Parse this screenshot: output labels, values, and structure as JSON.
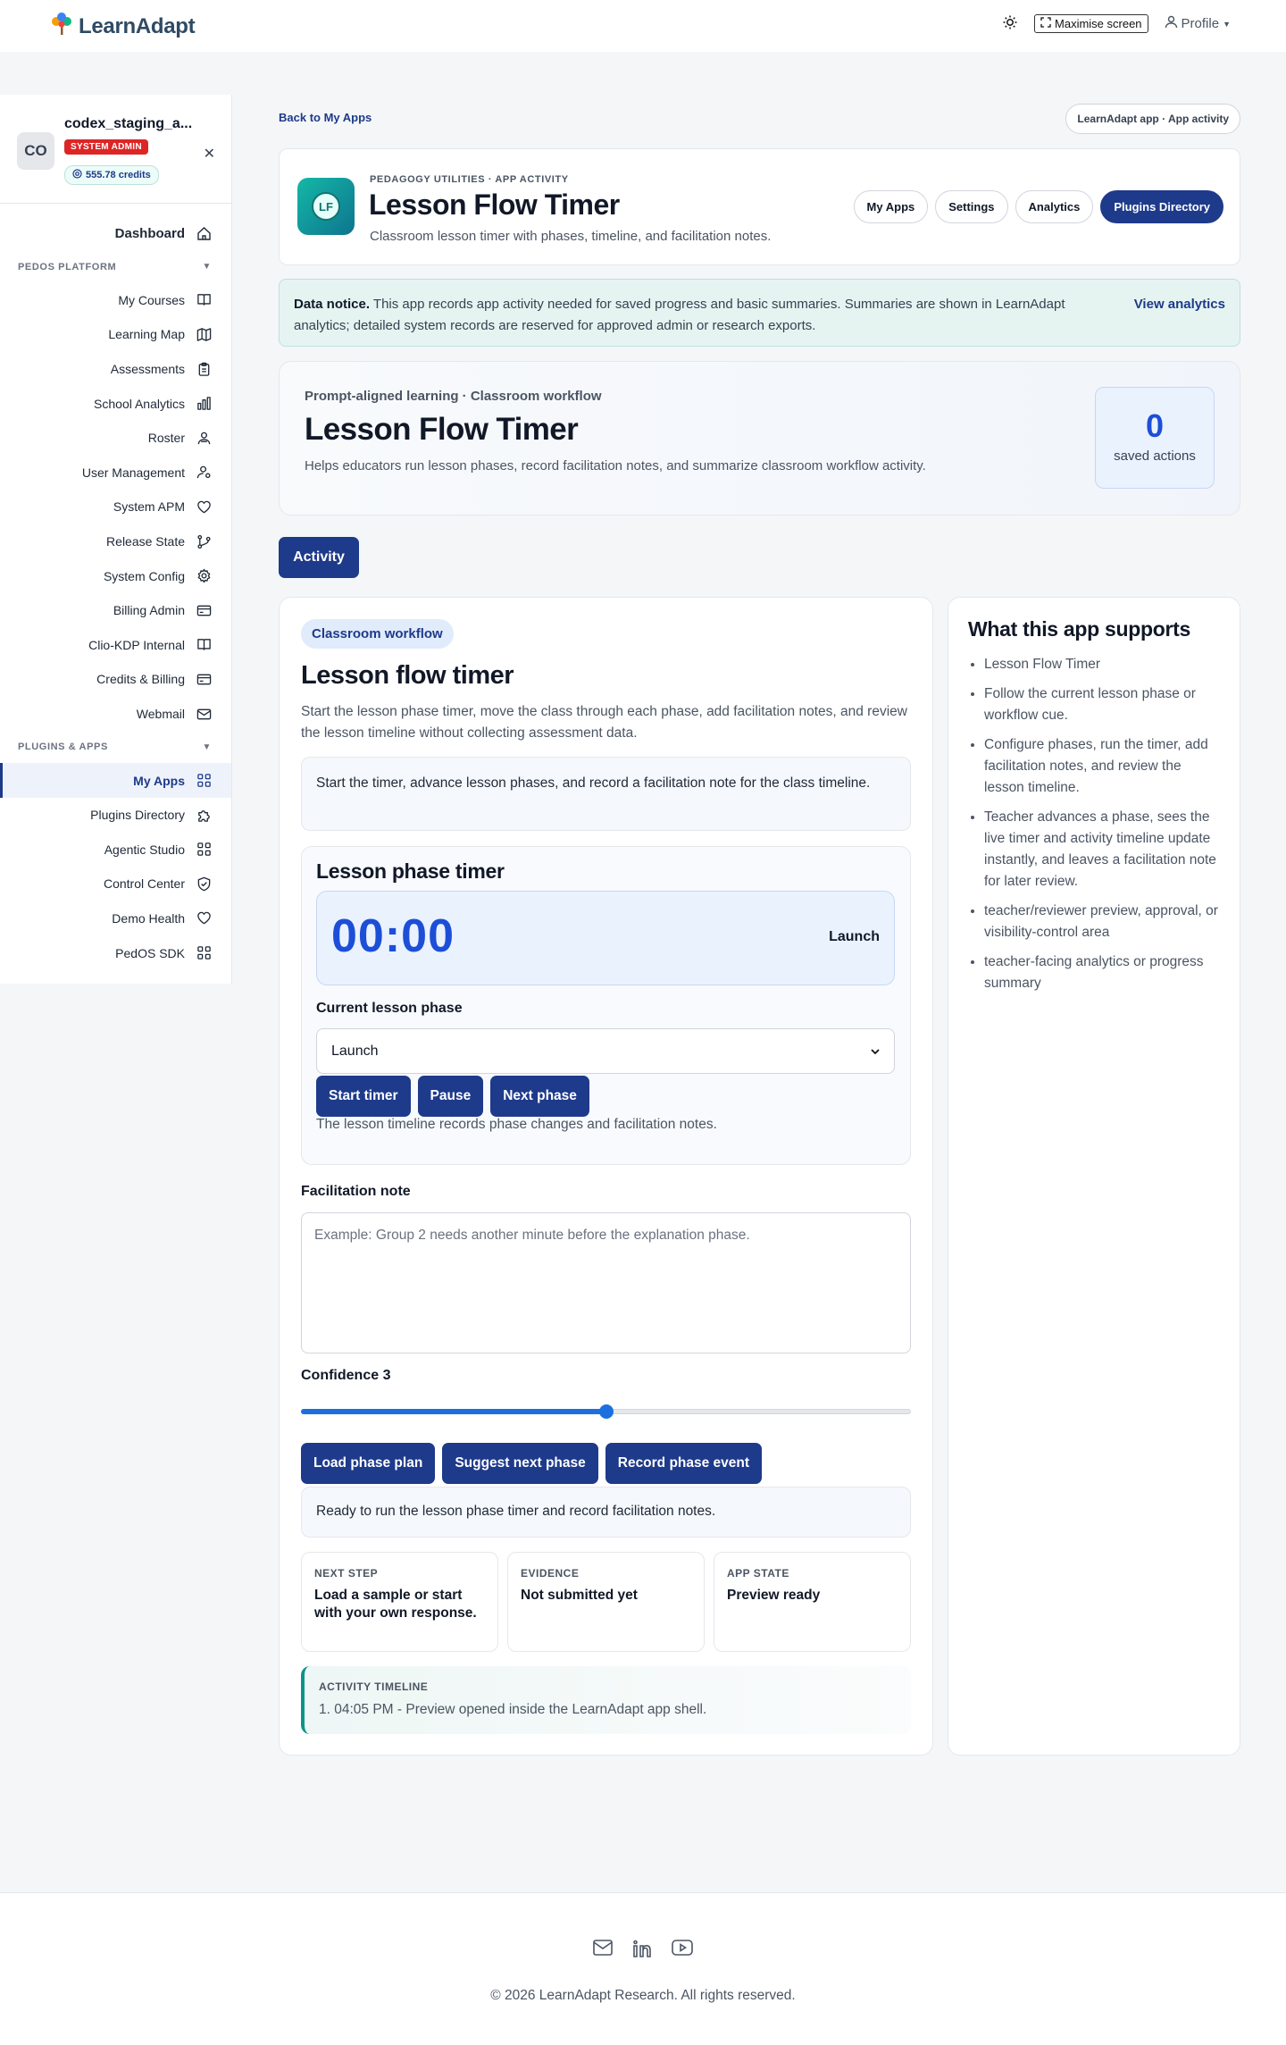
{
  "brand": {
    "name": "LearnAdapt"
  },
  "topbar": {
    "maximise_label": "Maximise screen",
    "profile_label": "Profile"
  },
  "sidebar": {
    "user": {
      "initials": "CO",
      "name": "codex_staging_a...",
      "role_badge": "SYSTEM ADMIN",
      "credits": "555.78 credits"
    },
    "dashboard": "Dashboard",
    "section_platform": "PEDOS PLATFORM",
    "platform_items": [
      {
        "label": "My Courses",
        "icon": "book-icon"
      },
      {
        "label": "Learning Map",
        "icon": "map-icon"
      },
      {
        "label": "Assessments",
        "icon": "clipboard-icon"
      },
      {
        "label": "School Analytics",
        "icon": "bar-chart-icon"
      },
      {
        "label": "Roster",
        "icon": "users-icon"
      },
      {
        "label": "User Management",
        "icon": "user-cog-icon"
      },
      {
        "label": "System APM",
        "icon": "heart-icon"
      },
      {
        "label": "Release State",
        "icon": "git-branch-icon"
      },
      {
        "label": "System Config",
        "icon": "gear-icon"
      },
      {
        "label": "Billing Admin",
        "icon": "credit-card-icon"
      },
      {
        "label": "Clio-KDP Internal",
        "icon": "book-icon"
      },
      {
        "label": "Credits & Billing",
        "icon": "credit-card-icon"
      },
      {
        "label": "Webmail",
        "icon": "mail-icon"
      }
    ],
    "section_plugins": "PLUGINS & APPS",
    "plugin_items": [
      {
        "label": "My Apps",
        "icon": "grid-icon"
      },
      {
        "label": "Plugins Directory",
        "icon": "puzzle-icon"
      },
      {
        "label": "Agentic Studio",
        "icon": "grid-icon"
      },
      {
        "label": "Control Center",
        "icon": "shield-icon"
      },
      {
        "label": "Demo Health",
        "icon": "heart-icon"
      },
      {
        "label": "PedOS SDK",
        "icon": "grid-icon"
      }
    ]
  },
  "page": {
    "back_link": "Back to My Apps",
    "context_pill": "LearnAdapt app · App activity",
    "header": {
      "icon_text": "LF",
      "eyebrow": "PEDAGOGY UTILITIES · APP ACTIVITY",
      "title": "Lesson Flow Timer",
      "subtitle": "Classroom lesson timer with phases, timeline, and facilitation notes.",
      "tabs": [
        "My Apps",
        "Settings",
        "Analytics",
        "Plugins Directory"
      ]
    },
    "notice": {
      "lead": "Data notice.",
      "text": " This app records app activity needed for saved progress and basic summaries. Summaries are shown in LearnAdapt analytics; detailed system records are reserved for approved admin or research exports.",
      "link": "View analytics"
    },
    "hero": {
      "eyebrow": "Prompt-aligned learning · Classroom workflow",
      "title": "Lesson Flow Timer",
      "subtitle": "Helps educators run lesson phases, record facilitation notes, and summarize classroom workflow activity.",
      "stat_value": "0",
      "stat_label": "saved actions"
    },
    "activity_tab": "Activity",
    "workflow": {
      "chip": "Classroom workflow",
      "title": "Lesson flow timer",
      "description": "Start the lesson phase timer, move the class through each phase, add facilitation notes, and review the lesson timeline without collecting assessment data.",
      "instruction": "Start the timer, advance lesson phases, and record a facilitation note for the class timeline.",
      "timer": {
        "heading": "Lesson phase timer",
        "value": "00:00",
        "phase_display": "Launch",
        "phase_label": "Current lesson phase",
        "phase_selected": "Launch",
        "buttons": [
          "Start timer",
          "Pause",
          "Next phase"
        ],
        "note": "The lesson timeline records phase changes and facilitation notes."
      },
      "facilitation_label": "Facilitation note",
      "facilitation_placeholder": "Example: Group 2 needs another minute before the explanation phase.",
      "confidence_label": "Confidence 3",
      "confidence_value": 3,
      "confidence_min": 1,
      "confidence_max": 5,
      "action_buttons": [
        "Load phase plan",
        "Suggest next phase",
        "Record phase event"
      ],
      "status": "Ready to run the lesson phase timer and record facilitation notes.",
      "info_cards": [
        {
          "key": "NEXT STEP",
          "value": "Load a sample or start with your own response."
        },
        {
          "key": "EVIDENCE",
          "value": "Not submitted yet"
        },
        {
          "key": "APP STATE",
          "value": "Preview ready"
        }
      ],
      "timeline_label": "ACTIVITY TIMELINE",
      "timeline_entry": "1. 04:05 PM - Preview opened inside the LearnAdapt app shell."
    },
    "supports": {
      "title": "What this app supports",
      "items": [
        "Lesson Flow Timer",
        "Follow the current lesson phase or workflow cue.",
        "Configure phases, run the timer, add facilitation notes, and review the lesson timeline.",
        "Teacher advances a phase, sees the live timer and activity timeline update instantly, and leaves a facilitation note for later review.",
        "teacher/reviewer preview, approval, or visibility-control area",
        "teacher-facing analytics or progress summary"
      ]
    }
  },
  "footer": {
    "copyright": "© 2026 LearnAdapt Research. All rights reserved."
  },
  "colors": {
    "primary": "#1e3a8a",
    "accent_blue": "#1d4ed8",
    "teal": "#0d9488",
    "danger": "#dc2626"
  }
}
